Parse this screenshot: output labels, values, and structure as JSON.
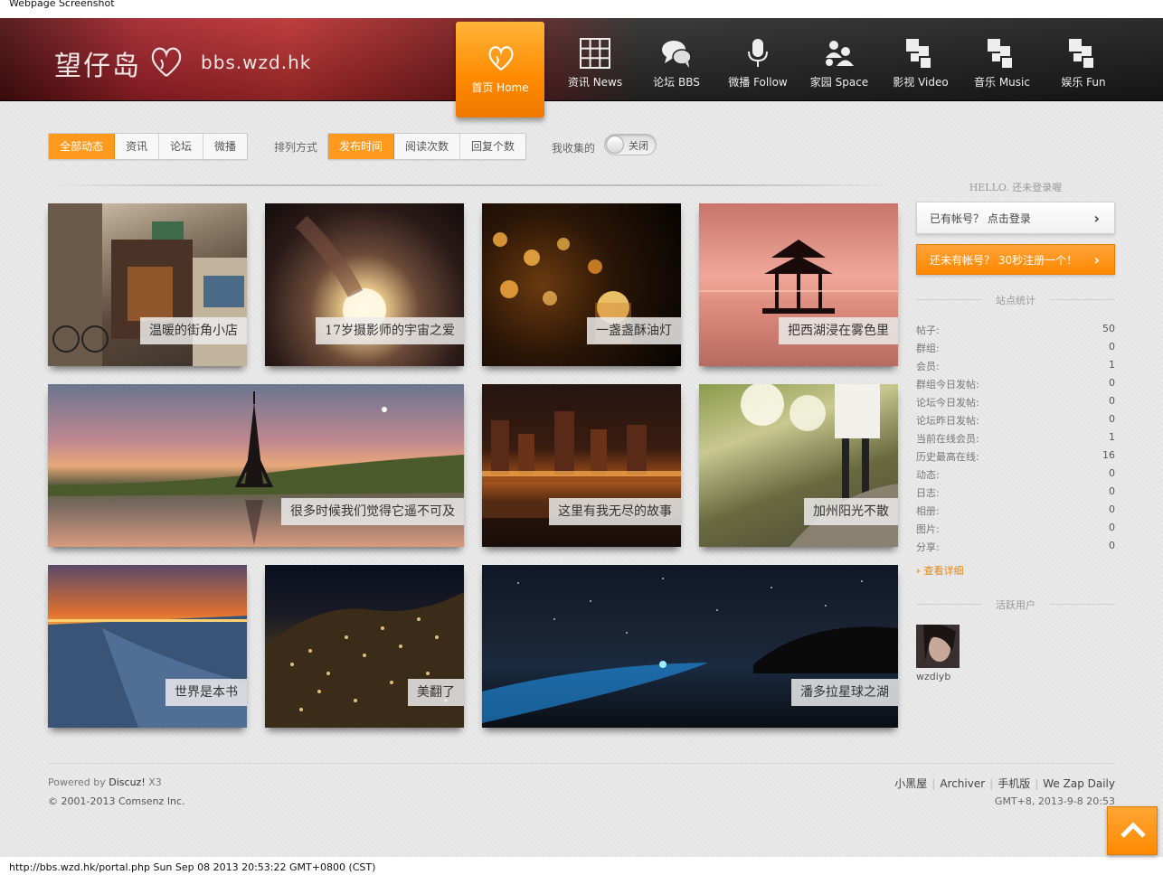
{
  "window": {
    "caption": "Webpage Screenshot"
  },
  "header": {
    "logo_text": "望仔岛",
    "site_url": "bbs.wzd.hk",
    "nav": [
      {
        "label": "首页 Home",
        "icon": "heart-logo-icon",
        "active": true
      },
      {
        "label": "资讯 News",
        "icon": "grid-icon"
      },
      {
        "label": "论坛 BBS",
        "icon": "chat-bubbles-icon"
      },
      {
        "label": "微播 Follow",
        "icon": "microphone-icon"
      },
      {
        "label": "家园 Space",
        "icon": "users-icon"
      },
      {
        "label": "影视 Video",
        "icon": "blocks-icon"
      },
      {
        "label": "音乐 Music",
        "icon": "blocks-icon"
      },
      {
        "label": "娱乐 Fun",
        "icon": "blocks-icon"
      }
    ],
    "accent": "#ff8a00"
  },
  "filters": {
    "type_tabs": [
      "全部动态",
      "资讯",
      "论坛",
      "微播"
    ],
    "sort_label": "排列方式",
    "sort_tabs": [
      "发布时间",
      "阅读次数",
      "回复个数"
    ],
    "fav_label": "我收集的",
    "toggle_text": "关闭"
  },
  "tiles": [
    {
      "caption": "温暖的街角小店"
    },
    {
      "caption": "17岁摄影师的宇宙之爱"
    },
    {
      "caption": "一盏盏酥油灯"
    },
    {
      "caption": "把西湖浸在雾色里"
    },
    {
      "caption": "很多时候我们觉得它遥不可及"
    },
    {
      "caption": "这里有我无尽的故事"
    },
    {
      "caption": "加州阳光不散"
    },
    {
      "caption": "世界是本书"
    },
    {
      "caption": "美翻了"
    },
    {
      "caption": "潘多拉星球之湖"
    }
  ],
  "sidebar": {
    "hello": "HELLO. 还未登录喔",
    "login_btn": "已有帐号？ 点击登录",
    "register_btn": "还未有帐号？ 30秒注册一个！",
    "stats_title": "站点统计",
    "stats": [
      {
        "k": "帖子:",
        "v": "50"
      },
      {
        "k": "群组:",
        "v": "0"
      },
      {
        "k": "会员:",
        "v": "1"
      },
      {
        "k": "群组今日发帖:",
        "v": "0"
      },
      {
        "k": "论坛今日发帖:",
        "v": "0"
      },
      {
        "k": "论坛昨日发帖:",
        "v": "0"
      },
      {
        "k": "当前在线会员:",
        "v": "1"
      },
      {
        "k": "历史最高在线:",
        "v": "16"
      },
      {
        "k": "动态:",
        "v": "0"
      },
      {
        "k": "日志:",
        "v": "0"
      },
      {
        "k": "相册:",
        "v": "0"
      },
      {
        "k": "图片:",
        "v": "0"
      },
      {
        "k": "分享:",
        "v": "0"
      }
    ],
    "more_link": "查看详细",
    "active_users_title": "活跃用户",
    "active_user": "wzdiyb"
  },
  "footer": {
    "powered_prefix": "Powered by ",
    "powered_name": "Discuz!",
    "powered_ver": " X3",
    "copyright": "© 2001-2013 Comsenz Inc.",
    "links": [
      "小黑屋",
      "Archiver",
      "手机版",
      "We Zap Daily"
    ],
    "time": "GMT+8, 2013-9-8 20:53"
  },
  "status_bar": "http://bbs.wzd.hk/portal.php Sun Sep 08 2013 20:53:22 GMT+0800 (CST)"
}
